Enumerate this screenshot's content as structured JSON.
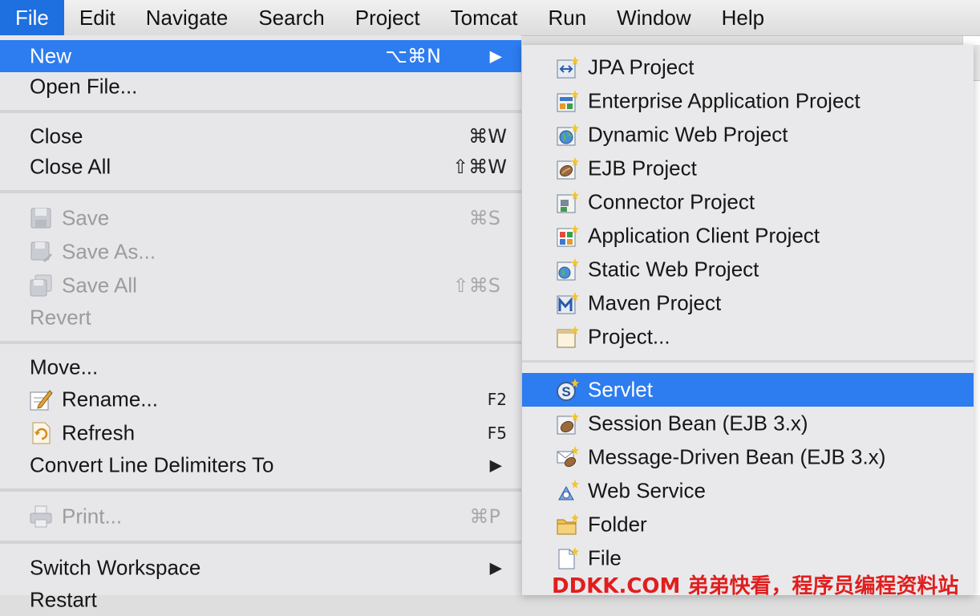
{
  "menubar": {
    "items": [
      {
        "label": "File",
        "active": true
      },
      {
        "label": "Edit"
      },
      {
        "label": "Navigate"
      },
      {
        "label": "Search"
      },
      {
        "label": "Project"
      },
      {
        "label": "Tomcat"
      },
      {
        "label": "Run"
      },
      {
        "label": "Window"
      },
      {
        "label": "Help"
      }
    ]
  },
  "file_menu": {
    "new": {
      "label": "New",
      "shortcut": "⌥⌘N",
      "submenu_arrow": "▶"
    },
    "open_file": {
      "label": "Open File..."
    },
    "close": {
      "label": "Close",
      "shortcut": "⌘W"
    },
    "close_all": {
      "label": "Close All",
      "shortcut": "⇧⌘W"
    },
    "save": {
      "label": "Save",
      "shortcut": "⌘S",
      "icon": "save-icon"
    },
    "save_as": {
      "label": "Save As...",
      "icon": "save-as-icon"
    },
    "save_all": {
      "label": "Save All",
      "shortcut": "⇧⌘S",
      "icon": "save-all-icon"
    },
    "revert": {
      "label": "Revert"
    },
    "move": {
      "label": "Move..."
    },
    "rename": {
      "label": "Rename...",
      "shortcut": "F2",
      "icon": "rename-icon"
    },
    "refresh": {
      "label": "Refresh",
      "shortcut": "F5",
      "icon": "refresh-icon"
    },
    "convert": {
      "label": "Convert Line Delimiters To",
      "submenu_arrow": "▶"
    },
    "print": {
      "label": "Print...",
      "shortcut": "⌘P",
      "icon": "print-icon"
    },
    "switch_workspace": {
      "label": "Switch Workspace",
      "submenu_arrow": "▶"
    },
    "restart": {
      "label": "Restart"
    }
  },
  "new_submenu": {
    "items": [
      {
        "label": "JPA Project",
        "icon": "jpa-project-icon"
      },
      {
        "label": "Enterprise Application Project",
        "icon": "enterprise-app-icon"
      },
      {
        "label": "Dynamic Web Project",
        "icon": "dynamic-web-icon"
      },
      {
        "label": "EJB Project",
        "icon": "ejb-project-icon"
      },
      {
        "label": "Connector Project",
        "icon": "connector-project-icon"
      },
      {
        "label": "Application Client Project",
        "icon": "app-client-icon"
      },
      {
        "label": "Static Web Project",
        "icon": "static-web-icon"
      },
      {
        "label": "Maven Project",
        "icon": "maven-project-icon"
      },
      {
        "label": "Project...",
        "icon": "project-icon"
      },
      {
        "label": "Servlet",
        "icon": "servlet-icon",
        "highlighted": true
      },
      {
        "label": "Session Bean (EJB 3.x)",
        "icon": "session-bean-icon"
      },
      {
        "label": "Message-Driven Bean (EJB 3.x)",
        "icon": "mdb-icon"
      },
      {
        "label": "Web Service",
        "icon": "web-service-icon"
      },
      {
        "label": "Folder",
        "icon": "folder-icon"
      },
      {
        "label": "File",
        "icon": "file-icon"
      }
    ]
  },
  "watermark": "DDKK.COM 弟弟快看，程序员编程资料站",
  "colors": {
    "highlight": "#2d7cf0",
    "menubar_active": "#1e6fe0",
    "watermark": "#e01e1e"
  }
}
